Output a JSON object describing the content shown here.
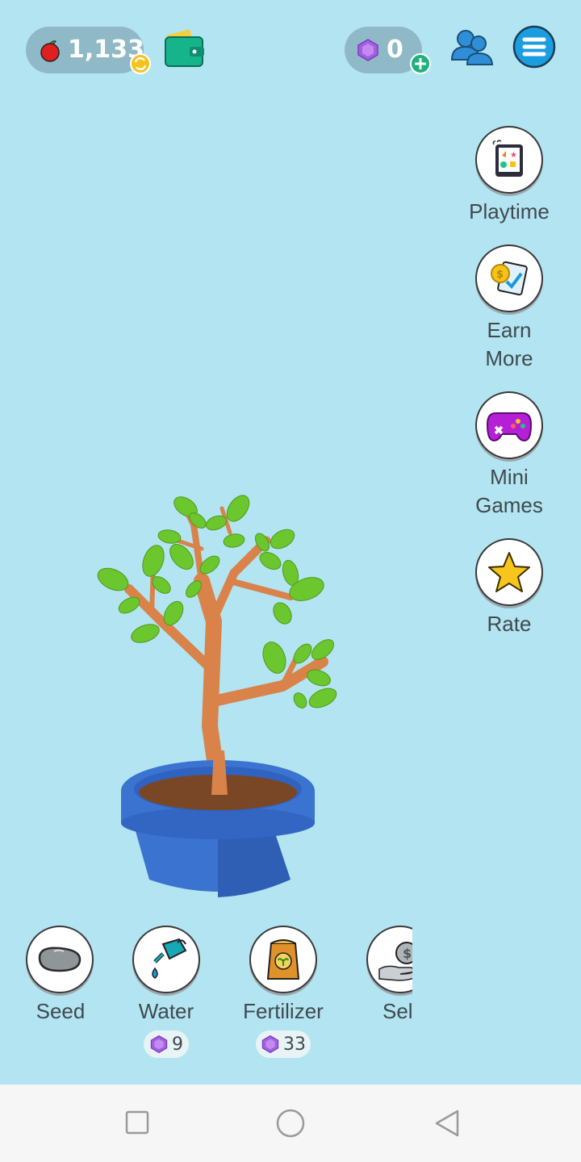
{
  "header": {
    "apples_count": "1,133",
    "gems_count": "0"
  },
  "side_menu": {
    "playtime_label": "Playtime",
    "earn_more_label": "Earn\nMore",
    "mini_games_label": "Mini\nGames",
    "rate_label": "Rate"
  },
  "actions": {
    "seed_label": "Seed",
    "water_label": "Water",
    "water_price": "9",
    "fertilizer_label": "Fertilizer",
    "fertilizer_price": "33",
    "sell_label": "Sel"
  },
  "colors": {
    "background": "#b3e4f1",
    "pot": "#3a74d0",
    "leaf": "#6cc62e",
    "trunk": "#d9824a",
    "gem": "#a25fe0"
  }
}
